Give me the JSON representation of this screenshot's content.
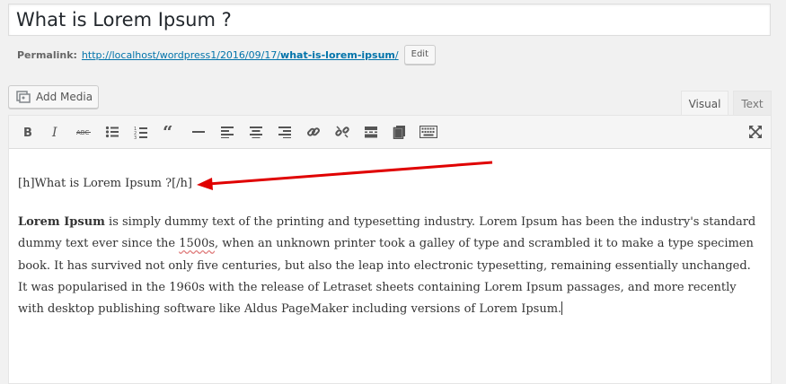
{
  "post": {
    "title": "What is Lorem Ipsum ?"
  },
  "permalink": {
    "label": "Permalink:",
    "url_base": "http://localhost/wordpress1/2016/09/17/",
    "url_slug": "what-is-lorem-ipsum",
    "url_trailing": "/",
    "edit_label": "Edit"
  },
  "media": {
    "add_media_label": "Add Media"
  },
  "tabs": [
    {
      "label": "Visual",
      "active": true
    },
    {
      "label": "Text",
      "active": false
    }
  ],
  "toolbar": {
    "buttons": [
      "bold-icon",
      "italic-icon",
      "strikethrough-icon",
      "bulleted-list-icon",
      "numbered-list-icon",
      "blockquote-icon",
      "horizontal-line-icon",
      "align-left-icon",
      "align-center-icon",
      "align-right-icon",
      "insert-link-icon",
      "remove-link-icon",
      "read-more-icon",
      "paste-as-text-icon",
      "toolbar-toggle-icon",
      "fullscreen-icon"
    ]
  },
  "content": {
    "shortcode_line": "[h]What is Lorem Ipsum ?[/h]",
    "para_bold": "Lorem Ipsum",
    "para_part1": " is simply dummy text of the printing and typesetting industry. Lorem Ipsum has been the industry's standard dummy text ever since the ",
    "para_spell": "1500s",
    "para_part2": ", when an unknown printer took a galley of type and scrambled it to make a type specimen book. It has survived not only five centuries, but also the leap into electronic typesetting, remaining essentially unchanged. It was popularised in the 1960s with the release of Letraset sheets containing Lorem Ipsum passages, and more recently with desktop publishing software like Aldus PageMaker including versions of Lorem Ipsum."
  },
  "colors": {
    "link": "#0073aa",
    "annotation_arrow": "#e00000"
  }
}
